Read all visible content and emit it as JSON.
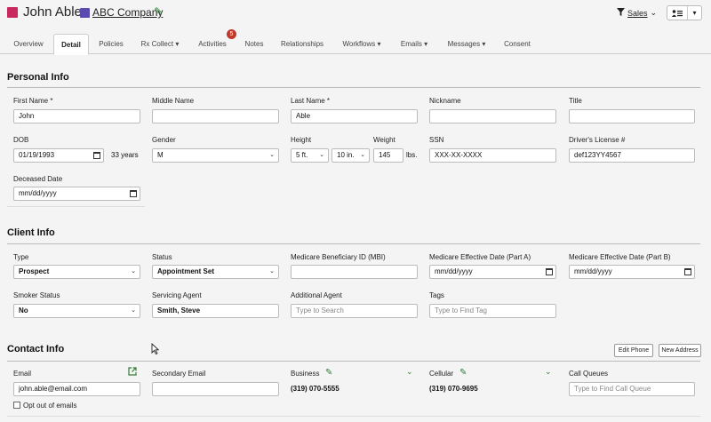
{
  "header": {
    "client_name": "John Able",
    "company_name": "ABC Company",
    "sales_label": "Sales",
    "colors": {
      "client": "#c8285d",
      "company": "#5d4ab0",
      "accent": "#2e7d32",
      "badge": "#c0392b"
    }
  },
  "tabs": [
    {
      "label": "Overview"
    },
    {
      "label": "Detail"
    },
    {
      "label": "Policies"
    },
    {
      "label": "Rx Collect"
    },
    {
      "label": "Activities",
      "badge": "5"
    },
    {
      "label": "Notes"
    },
    {
      "label": "Relationships"
    },
    {
      "label": "Workflows"
    },
    {
      "label": "Emails"
    },
    {
      "label": "Messages"
    },
    {
      "label": "Consent"
    }
  ],
  "personal_info": {
    "title": "Personal Info",
    "first_name_label": "First Name *",
    "first_name": "John",
    "middle_name_label": "Middle Name",
    "middle_name": "",
    "last_name_label": "Last Name *",
    "last_name": "Able",
    "nickname_label": "Nickname",
    "nickname": "",
    "title_label": "Title",
    "title_value": "",
    "dob_label": "DOB",
    "dob": "01/19/1993",
    "age": "33 years",
    "gender_label": "Gender",
    "gender": "M",
    "height_label": "Height",
    "height_ft": "5 ft.",
    "height_in": "10 in.",
    "weight_label": "Weight",
    "weight": "145",
    "weight_unit": "lbs.",
    "ssn_label": "SSN",
    "ssn": "XXX-XX-XXXX",
    "license_label": "Driver's License #",
    "license": "def123YY4567",
    "deceased_label": "Deceased Date",
    "deceased": "mm/dd/yyyy"
  },
  "client_info": {
    "title": "Client Info",
    "type_label": "Type",
    "type": "Prospect",
    "status_label": "Status",
    "status": "Appointment Set",
    "mbi_label": "Medicare Beneficiary ID (MBI)",
    "mbi": "",
    "part_a_label": "Medicare Effective Date (Part A)",
    "part_a": "mm/dd/yyyy",
    "part_b_label": "Medicare Effective Date (Part B)",
    "part_b": "mm/dd/yyyy",
    "smoker_label": "Smoker Status",
    "smoker": "No",
    "servicing_label": "Servicing Agent",
    "servicing": "Smith, Steve",
    "additional_label": "Additional Agent",
    "additional_placeholder": "Type to Search",
    "tags_label": "Tags",
    "tags_placeholder": "Type to Find Tag"
  },
  "contact_info": {
    "title": "Contact Info",
    "edit_phone": "Edit Phone",
    "new_address": "New Address",
    "email_label": "Email",
    "email": "john.able@email.com",
    "secondary_label": "Secondary Email",
    "secondary": "",
    "business_label": "Business",
    "business": "(319) 070-5555",
    "cellular_label": "Cellular",
    "cellular": "(319) 070-9695",
    "queues_label": "Call Queues",
    "queues_placeholder": "Type to Find Call Queue",
    "opt_out_label": "Opt out of emails"
  }
}
